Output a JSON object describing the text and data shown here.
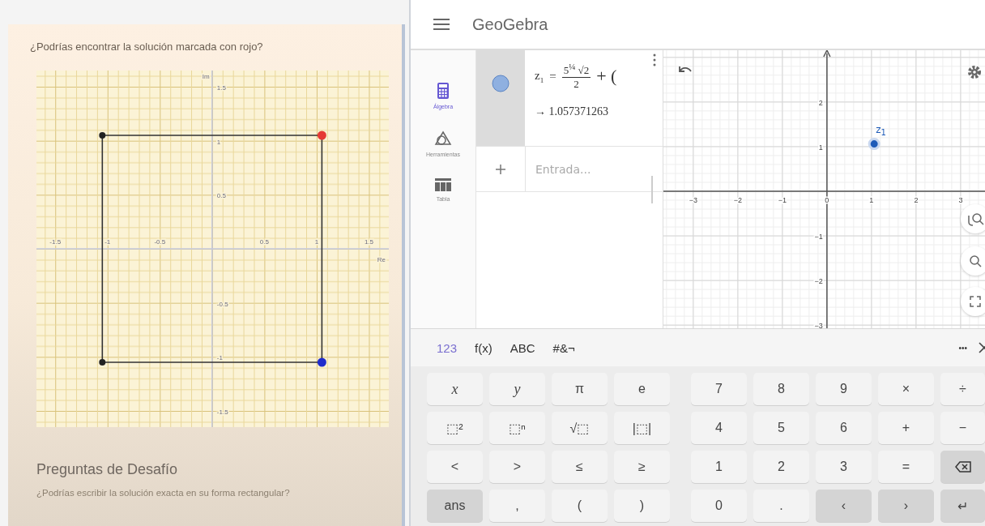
{
  "lesson": {
    "question": "¿Podrías encontrar la solución marcada con rojo?",
    "chart_data": {
      "type": "scatter",
      "xlabel": "Re",
      "ylabel": "Im",
      "x": [
        -1.05,
        1.05
      ],
      "series": [
        {
          "color": "#e53935",
          "values": [
            null,
            1.05
          ]
        },
        {
          "color": "#1f2ccc",
          "values": [
            null,
            -1.05
          ]
        },
        {
          "color": "#222222",
          "values": [
            1.05,
            null
          ]
        },
        {
          "color": "#222222",
          "values": [
            -1.05,
            null
          ]
        }
      ],
      "grid": true,
      "xlim": [
        -1.68,
        1.69
      ],
      "ylim": [
        -1.65,
        1.65
      ],
      "xticks": [
        -1.5,
        -1,
        -0.5,
        0.5,
        1,
        1.5
      ],
      "yticks": [
        -1.5,
        -1,
        -0.5,
        0.5,
        1,
        1.5
      ]
    },
    "heading": "Preguntas de Desafío",
    "subtitle": "¿Podrías escribir la solución exacta en su forma rectangular?"
  },
  "app": {
    "title": "GeoGebra",
    "sidebar": [
      {
        "label": "Álgebra",
        "kind": "calculator",
        "selected": true
      },
      {
        "label": "Herramientas",
        "kind": "tools",
        "selected": false
      },
      {
        "label": "Tabla",
        "kind": "table",
        "selected": false
      }
    ],
    "algebra": {
      "lhs": "z",
      "lhs_sub": "1",
      "eq": "=",
      "numerator": "5$^{¼}$ √2",
      "denominator": "2",
      "tail": "+ (",
      "result": "→ 1.057371263",
      "input_placeholder": "Entrada..."
    },
    "graphics": {
      "chart_data": {
        "type": "scatter",
        "x": [
          1.06
        ],
        "series": [
          {
            "color": "#1e5bb8",
            "values": [
              1.06
            ]
          }
        ],
        "grid": true,
        "xlim": [
          -3.67,
          3.62
        ],
        "ylim": [
          -3.07,
          3.16
        ],
        "xticks": [
          -3,
          -2,
          -1,
          0,
          1,
          2,
          3
        ],
        "yticks": [
          -3,
          -2,
          -1,
          1,
          2
        ],
        "annotations": [
          {
            "text": "z$_{1}$",
            "x": 1.06,
            "y": 1.06
          }
        ]
      }
    },
    "keyboard": {
      "tabs": [
        {
          "label": "123",
          "selected": true
        },
        {
          "label": "f(x)",
          "selected": false
        },
        {
          "label": "ABC",
          "selected": false
        },
        {
          "label": "#&¬",
          "selected": false
        }
      ],
      "more": "•••",
      "rows": [
        [
          {
            "label": "x",
            "kind": "variable"
          },
          {
            "label": "y",
            "kind": "variable"
          },
          {
            "label": "π",
            "kind": "key"
          },
          {
            "label": "e",
            "kind": "key"
          },
          {
            "label": "7",
            "kind": "key"
          },
          {
            "label": "8",
            "kind": "key"
          },
          {
            "label": "9",
            "kind": "key"
          },
          {
            "label": "×",
            "kind": "key"
          },
          {
            "label": "÷",
            "kind": "key"
          }
        ],
        [
          {
            "label": "⬚²",
            "kind": "key"
          },
          {
            "label": "⬚ⁿ",
            "kind": "key"
          },
          {
            "label": "√⬚",
            "kind": "key"
          },
          {
            "label": "|⬚|",
            "kind": "key"
          },
          {
            "label": "4",
            "kind": "key"
          },
          {
            "label": "5",
            "kind": "key"
          },
          {
            "label": "6",
            "kind": "key"
          },
          {
            "label": "+",
            "kind": "key"
          },
          {
            "label": "−",
            "kind": "key"
          }
        ],
        [
          {
            "label": "<",
            "kind": "key"
          },
          {
            "label": ">",
            "kind": "key"
          },
          {
            "label": "≤",
            "kind": "key"
          },
          {
            "label": "≥",
            "kind": "key"
          },
          {
            "label": "1",
            "kind": "key"
          },
          {
            "label": "2",
            "kind": "key"
          },
          {
            "label": "3",
            "kind": "key"
          },
          {
            "label": "=",
            "kind": "key"
          },
          {
            "kind": "backspace"
          }
        ],
        [
          {
            "label": "ans",
            "kind": "dark"
          },
          {
            "label": ",",
            "kind": "key"
          },
          {
            "label": "(",
            "kind": "key"
          },
          {
            "label": ")",
            "kind": "key"
          },
          {
            "label": "0",
            "kind": "key"
          },
          {
            "label": ".",
            "kind": "key"
          },
          {
            "label": "‹",
            "kind": "dark"
          },
          {
            "label": "›",
            "kind": "dark"
          },
          {
            "label": "↵",
            "kind": "dark"
          }
        ]
      ]
    }
  }
}
